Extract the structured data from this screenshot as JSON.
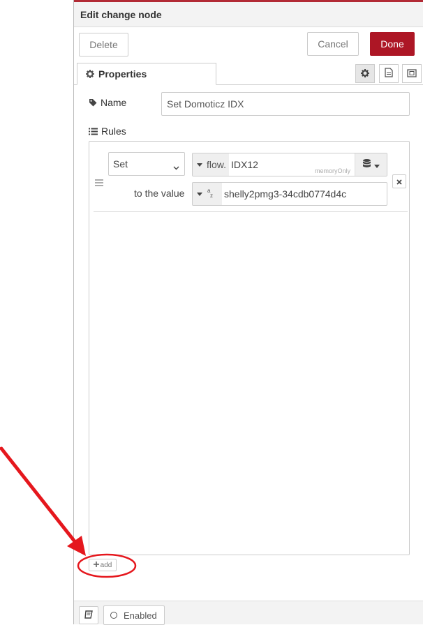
{
  "header": {
    "title": "Edit change node"
  },
  "toolbar": {
    "delete_label": "Delete",
    "cancel_label": "Cancel",
    "done_label": "Done"
  },
  "tabs": {
    "properties_label": "Properties"
  },
  "form": {
    "name_label": "Name",
    "name_value": "Set Domoticz IDX",
    "rules_label": "Rules"
  },
  "rule": {
    "action": "Set",
    "property_type": "flow.",
    "property_value": "IDX12",
    "store_label": "memoryOnly",
    "to_value_label": "to the value",
    "value": "shelly2pmg3-34cdb0774d4c"
  },
  "add_label": "add",
  "footer": {
    "enabled_label": "Enabled"
  },
  "colors": {
    "accent": "#ad1625",
    "annotation": "#e5171d"
  },
  "icons": [
    "gear-icon",
    "document-icon",
    "frame-icon",
    "tag-icon",
    "list-icon",
    "drag-handle-icon",
    "database-icon",
    "remove-icon",
    "plus-icon",
    "book-icon",
    "az-string-icon"
  ]
}
